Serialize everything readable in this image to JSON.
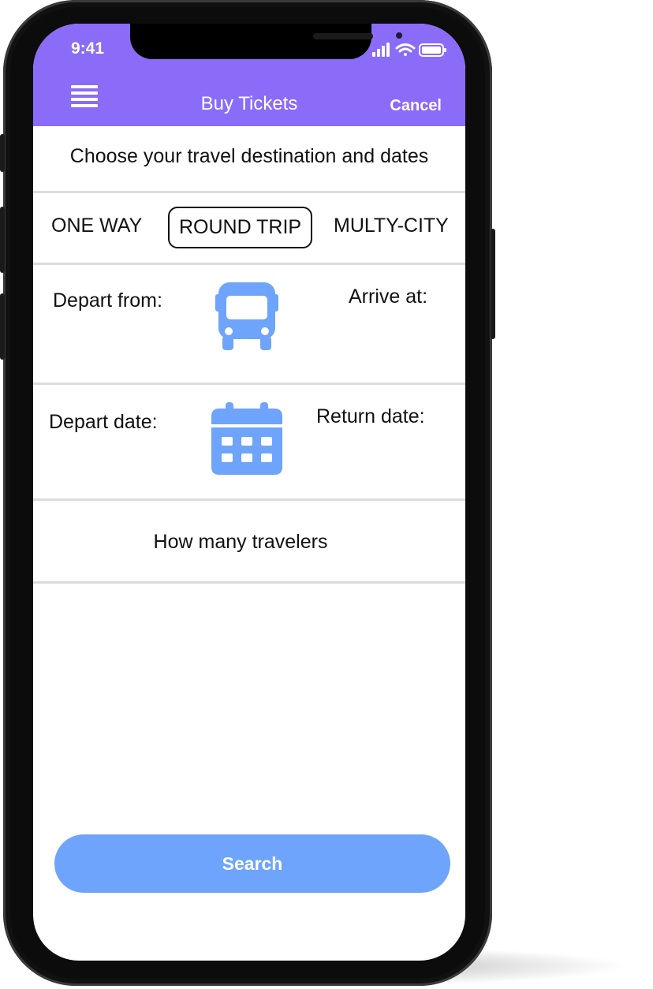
{
  "status_bar": {
    "time": "9:41"
  },
  "header": {
    "title": "Buy Tickets",
    "cancel_label": "Cancel",
    "menu_icon": "hamburger-menu-icon",
    "background": "#8a6cf8"
  },
  "subtitle": "Choose your travel destination and dates",
  "trip_types": {
    "one_way": "ONE WAY",
    "round_trip": "ROUND TRIP",
    "multi_city": "MULTY-CITY",
    "selected": "round_trip"
  },
  "route": {
    "depart_label": "Depart from:",
    "arrive_label": "Arrive at:",
    "icon": "bus-icon"
  },
  "dates": {
    "depart_label": "Depart date:",
    "return_label": "Return date:",
    "icon": "calendar-icon"
  },
  "travelers": {
    "label": "How many travelers"
  },
  "search": {
    "label": "Search",
    "color": "#6ea4fb"
  },
  "accent_icon_color": "#6ea4fb"
}
